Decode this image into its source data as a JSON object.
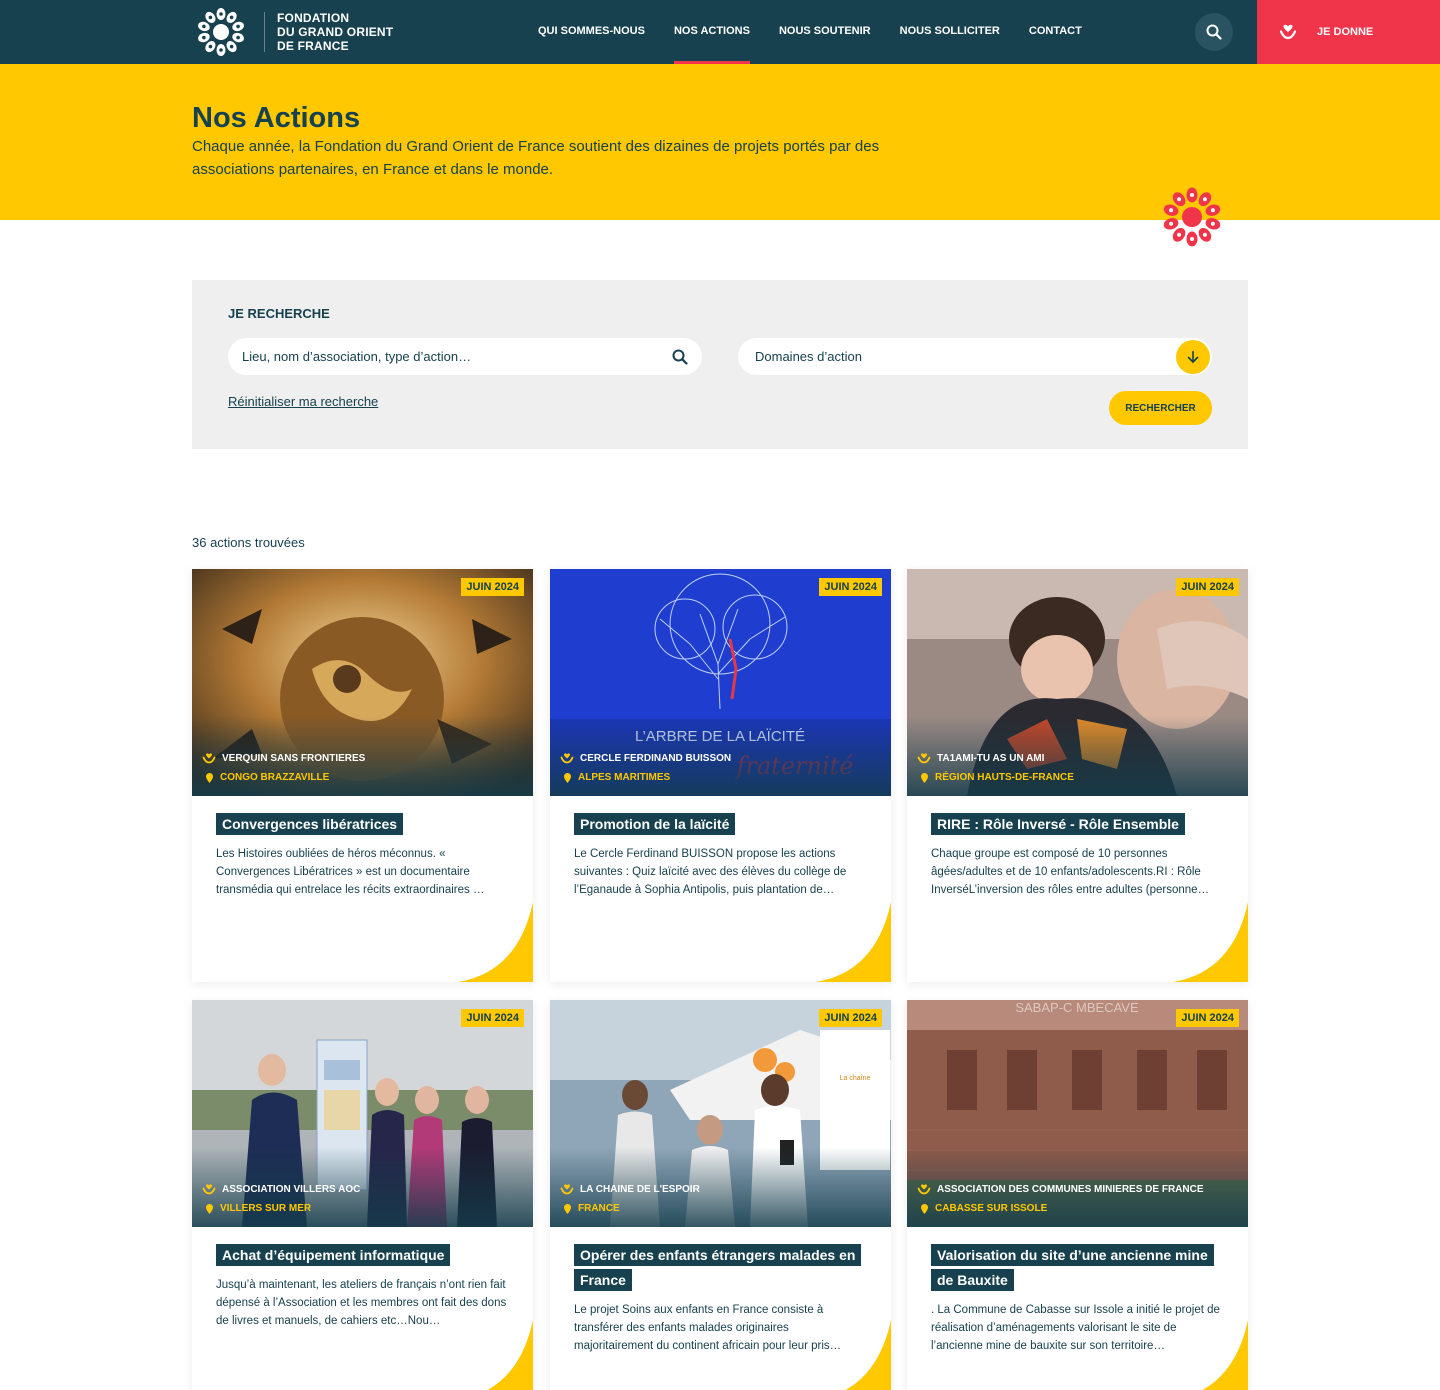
{
  "header": {
    "logo_lines": [
      "FONDATION",
      "DU GRAND ORIENT",
      "DE FRANCE"
    ],
    "nav": [
      {
        "label": "QUI SOMMES-NOUS",
        "active": false
      },
      {
        "label": "NOS ACTIONS",
        "active": true
      },
      {
        "label": "NOUS SOUTENIR",
        "active": false
      },
      {
        "label": "NOUS SOLLICITER",
        "active": false
      },
      {
        "label": "CONTACT",
        "active": false
      }
    ],
    "search_icon": "search-icon",
    "donate_label": "JE DONNE",
    "donate_icon": "heart-hand-icon"
  },
  "hero": {
    "title": "Nos Actions",
    "text": "Chaque année, la Fondation du Grand Orient de France soutient des dizaines de projets portés par des associations partenaires, en France et dans le monde."
  },
  "search": {
    "title": "JE RECHERCHE",
    "placeholder": "Lieu, nom d’association, type d’action…",
    "domains_label": "Domaines d’action",
    "reset_label": "Réinitialiser ma recherche",
    "submit_label": "RECHERCHER"
  },
  "results": {
    "count_label": "36 actions trouvées",
    "cards": [
      {
        "date": "JUIN 2024",
        "association": "VERQUIN SANS FRONTIERES",
        "location": "CONGO BRAZZAVILLE",
        "title": "Convergences libératrices",
        "text": "Les Histoires oubliées de héros méconnus. « Convergences Libératrices » est un documentaire transmédia qui entrelace les récits extraordinaires …"
      },
      {
        "date": "JUIN 2024",
        "association": "CERCLE FERDINAND BUISSON",
        "location": "ALPES MARITIMES",
        "title": "Promotion de la laïcité",
        "text": "Le Cercle Ferdinand BUISSON propose les actions suivantes : Quiz laïcité avec des élèves du collège de l’Eganaude à Sophia Antipolis, puis plantation de…",
        "image_text": "L’ARBRE DE LA LAÏCITÉ"
      },
      {
        "date": "JUIN 2024",
        "association": "TA1AMI-TU AS UN AMI",
        "location": "RÉGION HAUTS-DE-FRANCE",
        "title": "RIRE : Rôle Inversé - Rôle Ensemble",
        "text": "Chaque groupe est composé de 10 personnes âgées/adultes et de 10 enfants/adolescents.RI : Rôle InverséL’inversion des rôles entre adultes (personne…"
      },
      {
        "date": "JUIN 2024",
        "association": "ASSOCIATION VILLERS AOC",
        "location": "VILLERS SUR MER",
        "title": "Achat d’équipement informatique",
        "text": "Jusqu’à maintenant, les ateliers de français n’ont rien fait dépensé à l’Association et les membres ont fait des dons de livres et manuels, de cahiers etc…Nou…"
      },
      {
        "date": "JUIN 2024",
        "association": "LA CHAINE DE L'ESPOIR",
        "location": "FRANCE",
        "title": "Opérer des enfants étrangers malades en France",
        "text": "Le projet Soins aux enfants en France consiste à transférer des enfants malades originaires majoritairement du continent africain pour leur pris…"
      },
      {
        "date": "JUIN 2024",
        "association": "ASSOCIATION DES COMMUNES MINIERES DE FRANCE",
        "location": "CABASSE SUR ISSOLE",
        "title": "Valorisation du site d’une ancienne mine de Bauxite",
        "text": ". La Commune de Cabasse sur Issole a initié le projet de réalisation d’aménagements valorisant le site de l’ancienne mine de bauxite sur son territoire…"
      }
    ]
  },
  "colors": {
    "primary": "#17414f",
    "accent_yellow": "#ffc800",
    "accent_red": "#f0344a"
  }
}
